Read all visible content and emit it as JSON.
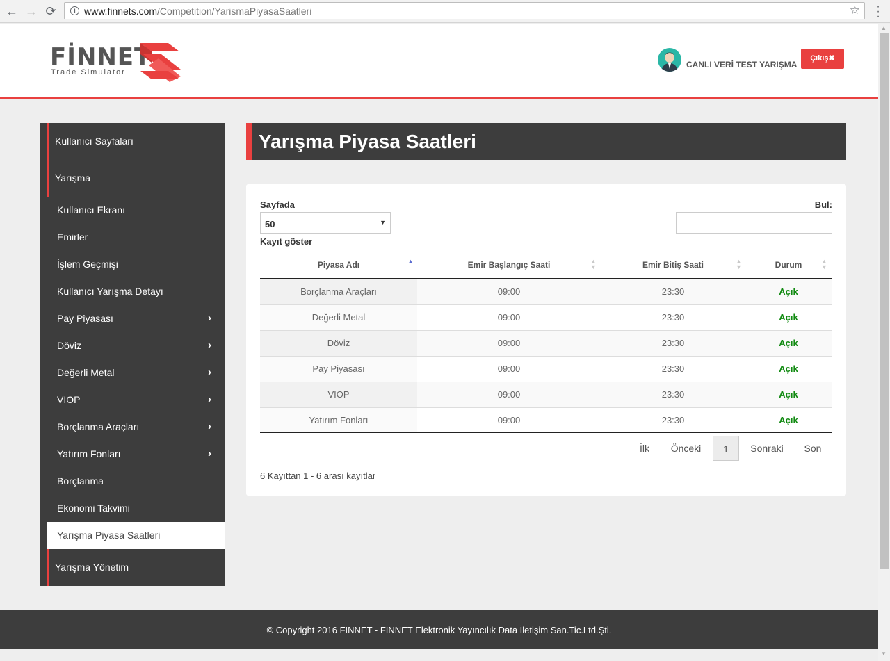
{
  "browser": {
    "url_host": "www.finnets.com",
    "url_path": "/Competition/YarismaPiyasaSaatleri"
  },
  "header": {
    "logo_text": "FİNNET",
    "logo_sub": "Trade Simulator",
    "user_name": "CANLI VERİ TEST YARIŞMA",
    "logout_label": "Çıkış✖"
  },
  "sidebar": {
    "sections": [
      {
        "label": "Kullanıcı Sayfaları"
      },
      {
        "label": "Yarışma"
      },
      {
        "label": "Yarışma Yönetim"
      }
    ],
    "items": [
      {
        "label": "Kullanıcı Ekranı",
        "has_submenu": false
      },
      {
        "label": "Emirler",
        "has_submenu": false
      },
      {
        "label": "İşlem Geçmişi",
        "has_submenu": false
      },
      {
        "label": "Kullanıcı Yarışma Detayı",
        "has_submenu": false
      },
      {
        "label": "Pay Piyasası",
        "has_submenu": true
      },
      {
        "label": "Döviz",
        "has_submenu": true
      },
      {
        "label": "Değerli Metal",
        "has_submenu": true
      },
      {
        "label": "VIOP",
        "has_submenu": true
      },
      {
        "label": "Borçlanma Araçları",
        "has_submenu": true
      },
      {
        "label": "Yatırım Fonları",
        "has_submenu": true
      },
      {
        "label": "Borçlanma",
        "has_submenu": false
      },
      {
        "label": "Ekonomi Takvimi",
        "has_submenu": false
      },
      {
        "label": "Yarışma Piyasa Saatleri",
        "has_submenu": false,
        "active": true
      }
    ]
  },
  "main": {
    "title": "Yarışma Piyasa Saatleri",
    "page_size_label": "Sayfada",
    "page_size_value": "50",
    "records_label": "Kayıt göster",
    "search_label": "Bul:",
    "search_value": "",
    "table": {
      "columns": [
        "Piyasa Adı",
        "Emir Başlangıç Saati",
        "Emir Bitiş Saati",
        "Durum"
      ],
      "rows": [
        [
          "Borçlanma Araçları",
          "09:00",
          "23:30",
          "Açık"
        ],
        [
          "Değerli Metal",
          "09:00",
          "23:30",
          "Açık"
        ],
        [
          "Döviz",
          "09:00",
          "23:30",
          "Açık"
        ],
        [
          "Pay Piyasası",
          "09:00",
          "23:30",
          "Açık"
        ],
        [
          "VIOP",
          "09:00",
          "23:30",
          "Açık"
        ],
        [
          "Yatırım Fonları",
          "09:00",
          "23:30",
          "Açık"
        ]
      ]
    },
    "pager": {
      "first": "İlk",
      "prev": "Önceki",
      "current": "1",
      "next": "Sonraki",
      "last": "Son"
    },
    "info": "6 Kayıttan 1 - 6 arası kayıtlar"
  },
  "footer": {
    "text": "© Copyright 2016 FINNET - FINNET Elektronik Yayıncılık Data İletişim San.Tic.Ltd.Şti."
  },
  "colors": {
    "accent": "#e9403f",
    "dark": "#3d3d3d",
    "status_open": "#118a11"
  },
  "icons": {
    "back": "arrow-left-icon",
    "forward": "arrow-right-icon",
    "reload": "reload-icon",
    "info": "info-icon",
    "bookmark": "star-icon",
    "menu": "more-vert-icon",
    "submenu": "chevron-right-icon",
    "sort": "sort-icon"
  }
}
